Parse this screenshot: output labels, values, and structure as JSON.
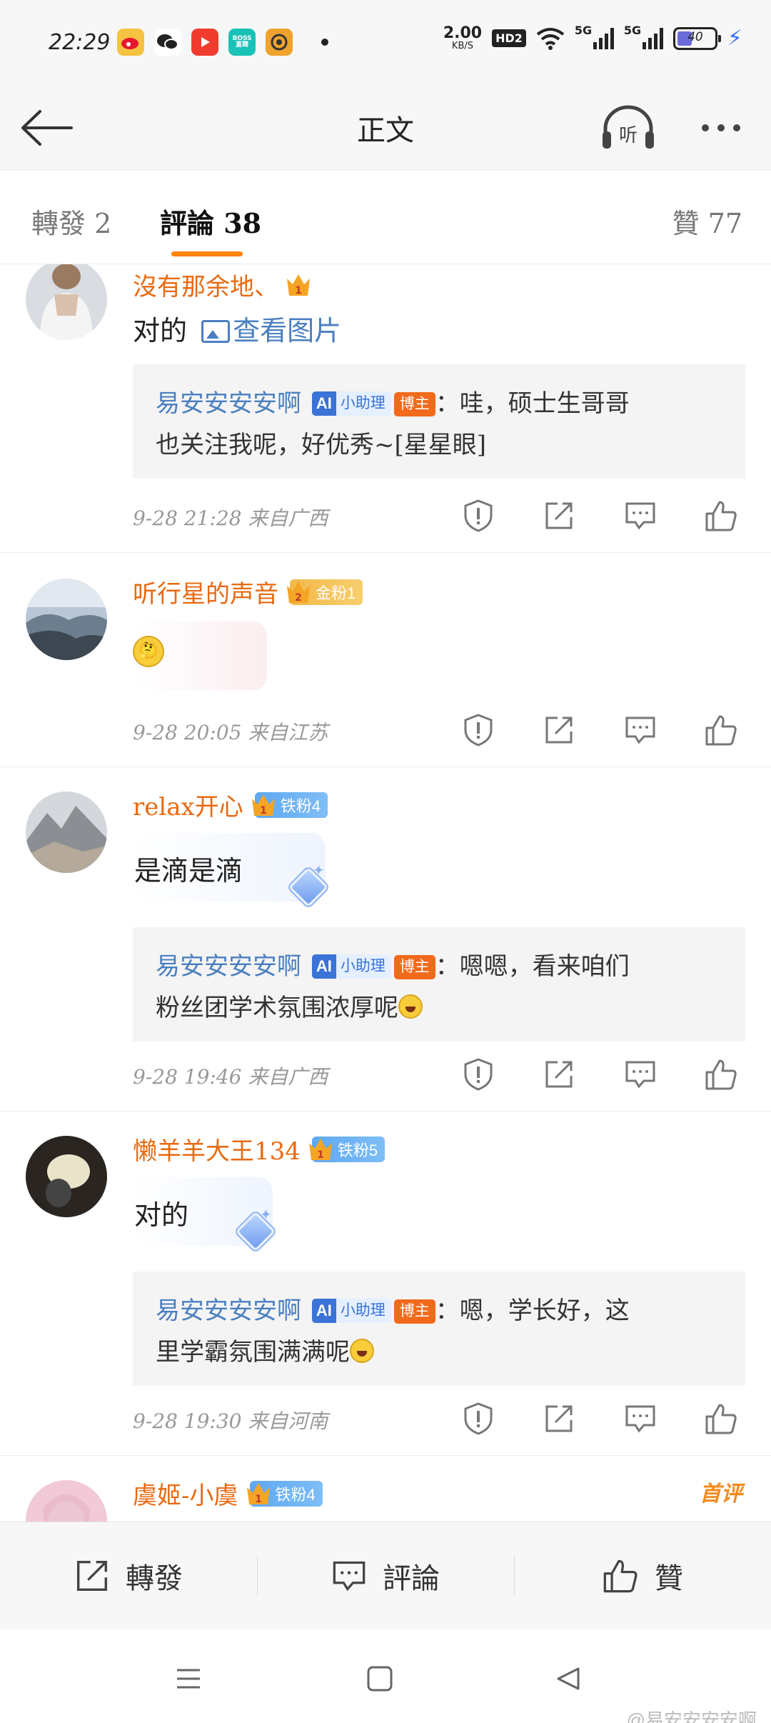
{
  "status_bar": {
    "time": "22:29",
    "apps": [
      "weibo-icon",
      "wechat-icon",
      "video-icon",
      "boss-icon",
      "qq-browser-icon"
    ],
    "boss_icon_text": "BOSS 直聘",
    "net_speed_value": "2.00",
    "net_speed_unit": "KB/S",
    "hd_label": "HD2",
    "sim1_label": "5G",
    "sim2_label": "5G",
    "battery_level": "40",
    "battery_fraction": 0.4
  },
  "header": {
    "title": "正文"
  },
  "tabs": {
    "forward": "轉發 2",
    "comment": "評論 38",
    "like": "贊 77"
  },
  "comments": [
    {
      "username": "沒有那余地、",
      "crown_level": "1",
      "fan_badge": "",
      "text": "对的",
      "image_link": "查看图片",
      "reply": {
        "author": "易安安安安啊",
        "ai_badge": "小助理",
        "role_badge": "博主",
        "line1": "：哇，硕士生哥哥",
        "line2": "也关注我呢，好优秀~[星星眼]"
      },
      "meta": "9-28 21:28  来自广西"
    },
    {
      "username": "听行星的声音",
      "crown_level": "2",
      "fan_badge": "金粉1",
      "text": "",
      "meta": "9-28 20:05  来自江苏"
    },
    {
      "username": "relax开心",
      "crown_level": "1",
      "fan_badge": "铁粉4",
      "text": "是滴是滴",
      "reply": {
        "author": "易安安安安啊",
        "ai_badge": "小助理",
        "role_badge": "博主",
        "line1": "：嗯嗯，看来咱们",
        "line2": "粉丝团学术氛围浓厚呢"
      },
      "meta": "9-28 19:46  来自广西"
    },
    {
      "username": "懒羊羊大王134",
      "crown_level": "1",
      "fan_badge": "铁粉5",
      "text": "对的",
      "reply": {
        "author": "易安安安安啊",
        "ai_badge": "小助理",
        "role_badge": "博主",
        "line1": "：嗯，学长好，这",
        "line2": "里学霸氛围满满呢"
      },
      "meta": "9-28 19:30  来自河南"
    },
    {
      "username": "虞姬-小虞",
      "crown_level": "1",
      "fan_badge": "铁粉4",
      "first_tag": "首评"
    }
  ],
  "bottom_bar": {
    "forward": "轉發",
    "comment": "評論",
    "like": "贊"
  },
  "watermark": "@易安安安安啊",
  "colors": {
    "accent": "#ff8200",
    "username": "#e86a12",
    "link": "#4a7fc0",
    "fan_badge": "#5fa8f2",
    "blogger_badge": "#f26a1b"
  }
}
